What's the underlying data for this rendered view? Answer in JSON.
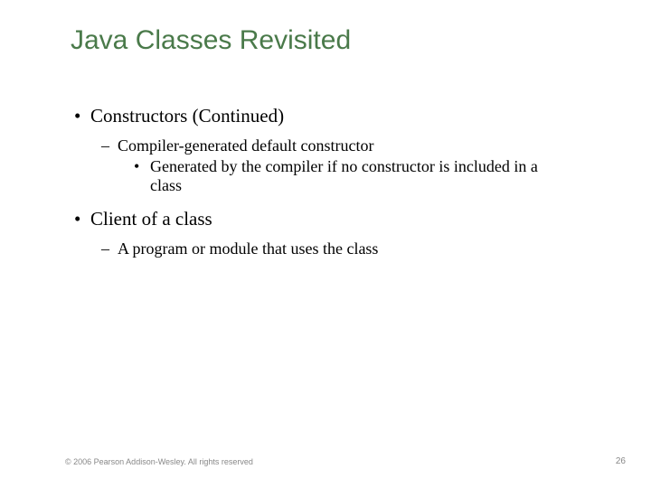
{
  "title": "Java Classes Revisited",
  "items": {
    "b1": "Constructors (Continued)",
    "b1_1": "Compiler-generated default constructor",
    "b1_1_1": "Generated by the compiler if no constructor is included in a class",
    "b2": "Client of a class",
    "b2_1": "A program or module that uses the class"
  },
  "footer": {
    "copyright": "© 2006 Pearson Addison-Wesley. All rights reserved",
    "page": "26"
  }
}
